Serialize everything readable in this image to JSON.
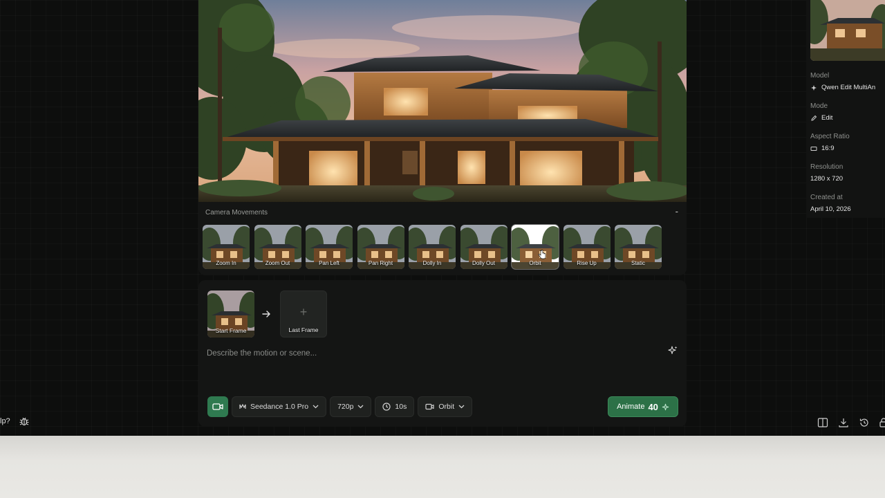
{
  "camera_panel": {
    "title": "Camera Movements",
    "collapse_label": "-",
    "movements": [
      {
        "label": "Zoom In"
      },
      {
        "label": "Zoom Out"
      },
      {
        "label": "Pan Left"
      },
      {
        "label": "Pan Right"
      },
      {
        "label": "Dolly In"
      },
      {
        "label": "Dolly Out"
      },
      {
        "label": "Orbit"
      },
      {
        "label": "Rise Up"
      },
      {
        "label": "Static"
      }
    ]
  },
  "composer": {
    "start_frame_label": "Start Frame",
    "last_frame_label": "Last Frame",
    "last_frame_plus": "+",
    "prompt_placeholder": "Describe the motion or scene...",
    "model_label": "Seedance 1.0 Pro",
    "resolution_label": "720p",
    "duration_label": "10s",
    "movement_label": "Orbit",
    "animate_label": "Animate",
    "animate_cost": "40"
  },
  "info": {
    "model_label": "Model",
    "model_value": "Qwen Edit MultiAn",
    "mode_label": "Mode",
    "mode_value": "Edit",
    "aspect_label": "Aspect Ratio",
    "aspect_value": "16:9",
    "resolution_label": "Resolution",
    "resolution_value": "1280 x 720",
    "created_label": "Created at",
    "created_value": "April 10, 2026"
  },
  "footer": {
    "help_text": "lp?"
  },
  "colors": {
    "accent_green": "#2c7147",
    "background": "#0d0e0d",
    "panel": "#141514"
  }
}
